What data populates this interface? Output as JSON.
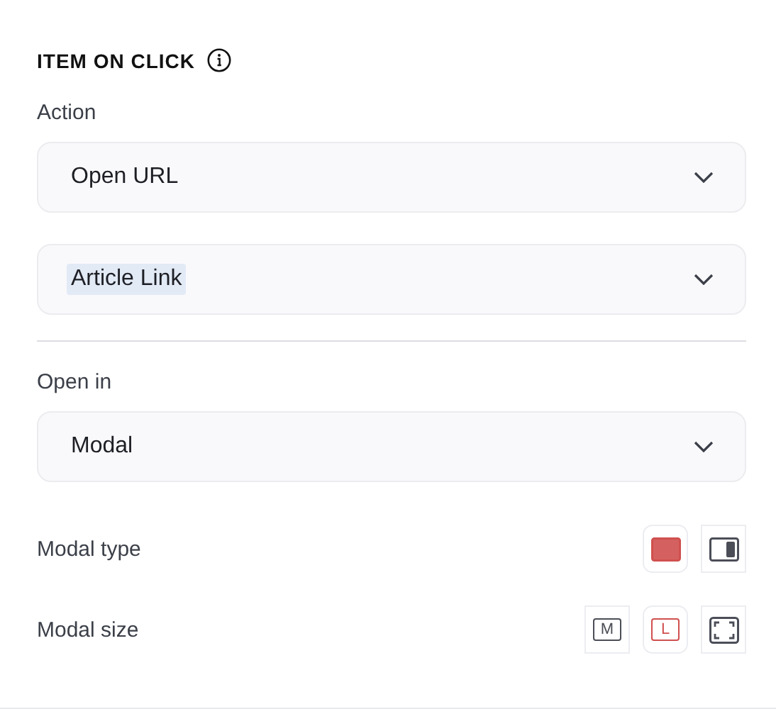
{
  "section": {
    "title": "ITEM ON CLICK"
  },
  "action": {
    "label": "Action",
    "selects": [
      {
        "value": "Open URL",
        "highlighted": false
      },
      {
        "value": "Article Link",
        "highlighted": true
      }
    ]
  },
  "open_in": {
    "label": "Open in",
    "selects": [
      {
        "value": "Modal",
        "highlighted": false
      }
    ]
  },
  "modal_type": {
    "label": "Modal type",
    "options": [
      {
        "kind": "center",
        "selected": true
      },
      {
        "kind": "side",
        "selected": false
      }
    ]
  },
  "modal_size": {
    "label": "Modal size",
    "options": [
      {
        "kind": "letter",
        "text": "M",
        "selected": false
      },
      {
        "kind": "letter",
        "text": "L",
        "selected": true
      },
      {
        "kind": "full",
        "selected": false
      }
    ]
  }
}
